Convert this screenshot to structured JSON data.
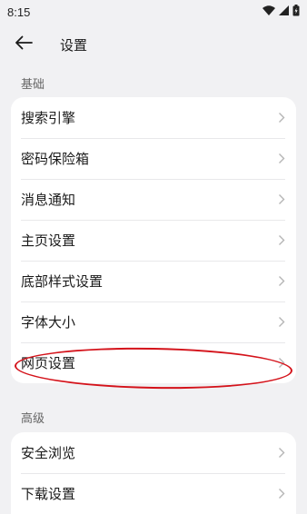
{
  "status_bar": {
    "time": "8:15",
    "icons": [
      "wifi-icon",
      "signal-icon",
      "battery-icon"
    ]
  },
  "app_bar": {
    "back_icon": "arrow-left-icon",
    "title": "设置"
  },
  "sections": [
    {
      "label": "基础",
      "items": [
        {
          "label": "搜索引擎"
        },
        {
          "label": "密码保险箱"
        },
        {
          "label": "消息通知"
        },
        {
          "label": "主页设置"
        },
        {
          "label": "底部样式设置"
        },
        {
          "label": "字体大小"
        },
        {
          "label": "网页设置",
          "highlighted": true
        }
      ]
    },
    {
      "label": "高级",
      "items": [
        {
          "label": "安全浏览"
        },
        {
          "label": "下载设置"
        }
      ]
    }
  ],
  "colors": {
    "background": "#f1f1f3",
    "card": "#ffffff",
    "annotation": "#d4121a",
    "chevron": "#b5b5b5"
  }
}
